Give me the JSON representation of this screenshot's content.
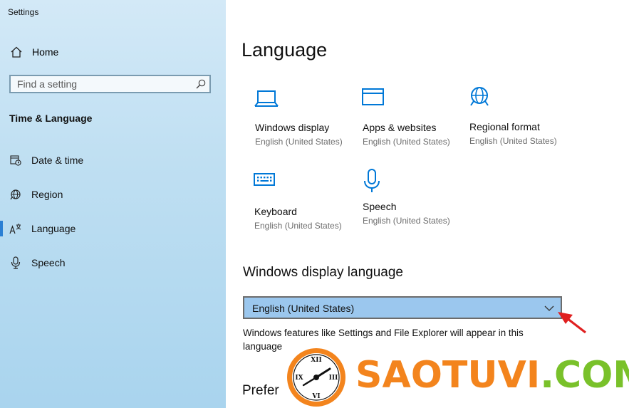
{
  "window": {
    "title": "Settings"
  },
  "sidebar": {
    "home_label": "Home",
    "search": {
      "placeholder": "Find a setting"
    },
    "section_heading": "Time & Language",
    "items": [
      {
        "label": "Date & time",
        "icon": "calendar-clock-icon"
      },
      {
        "label": "Region",
        "icon": "globe-icon"
      },
      {
        "label": "Language",
        "icon": "language-icon",
        "active": true
      },
      {
        "label": "Speech",
        "icon": "microphone-icon"
      }
    ]
  },
  "main": {
    "title": "Language",
    "tiles": [
      {
        "name": "Windows display",
        "sub": "English (United States)",
        "icon": "laptop-icon"
      },
      {
        "name": "Apps & websites",
        "sub": "English (United States)",
        "icon": "window-icon"
      },
      {
        "name": "Regional format",
        "sub": "English (United States)",
        "icon": "globe-icon"
      },
      {
        "name": "Keyboard",
        "sub": "English (United States)",
        "icon": "keyboard-icon"
      },
      {
        "name": "Speech",
        "sub": "English (United States)",
        "icon": "microphone-icon"
      }
    ],
    "display_language": {
      "heading": "Windows display language",
      "selected": "English (United States)",
      "description": "Windows features like Settings and File Explorer will appear in this language"
    },
    "next_heading": "Prefer"
  },
  "colors": {
    "accent": "#0078d7",
    "select_bg": "#9bc7ee",
    "arrow": "#e02020"
  },
  "watermark": {
    "text_part1": "SAOTUVI",
    "text_part2": ".COM",
    "clock_numerals": [
      "XII",
      "III",
      "VI",
      "IX"
    ]
  }
}
